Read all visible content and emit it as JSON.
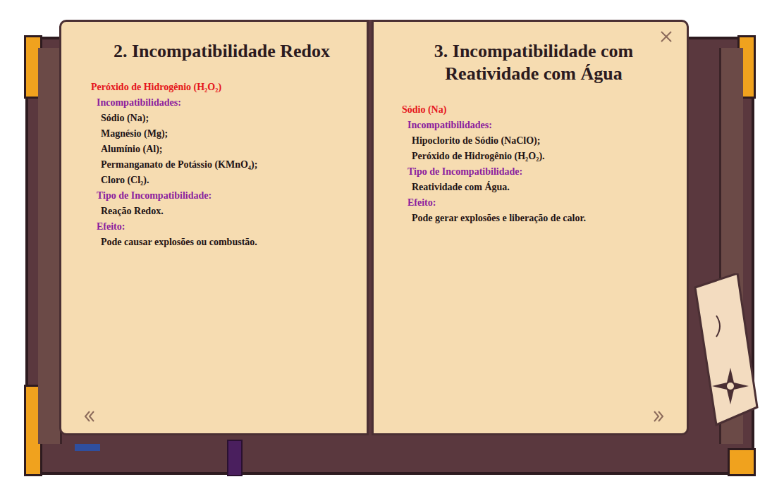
{
  "book": {
    "pages": [
      {
        "title": "2. Incompatibilidade Redox",
        "substance": "Peróxido de Hidrogênio (H₂O₂)",
        "incompatibilities_label": "Incompatibilidades:",
        "incompatibilities": [
          "Sódio (Na);",
          "Magnésio (Mg);",
          "Alumínio (Al);",
          "Permanganato de Potássio (KMnO₄);",
          "Cloro (Cl₂)."
        ],
        "type_label": "Tipo de Incompatibilidade:",
        "type": "Reação Redox.",
        "effect_label": "Efeito:",
        "effect": "Pode causar explosões ou combustão."
      },
      {
        "title": "3. Incompatibilidade com Reatividade com Água",
        "substance": "Sódio (Na)",
        "incompatibilities_label": "Incompatibilidades:",
        "incompatibilities": [
          "Hipoclorito de Sódio (NaClO);",
          "Peróxido de Hidrogênio (H₂O₂)."
        ],
        "type_label": "Tipo de Incompatibilidade:",
        "type": "Reatividade com Água.",
        "effect_label": "Efeito:",
        "effect": "Pode gerar explosões e liberação de calor."
      }
    ]
  }
}
